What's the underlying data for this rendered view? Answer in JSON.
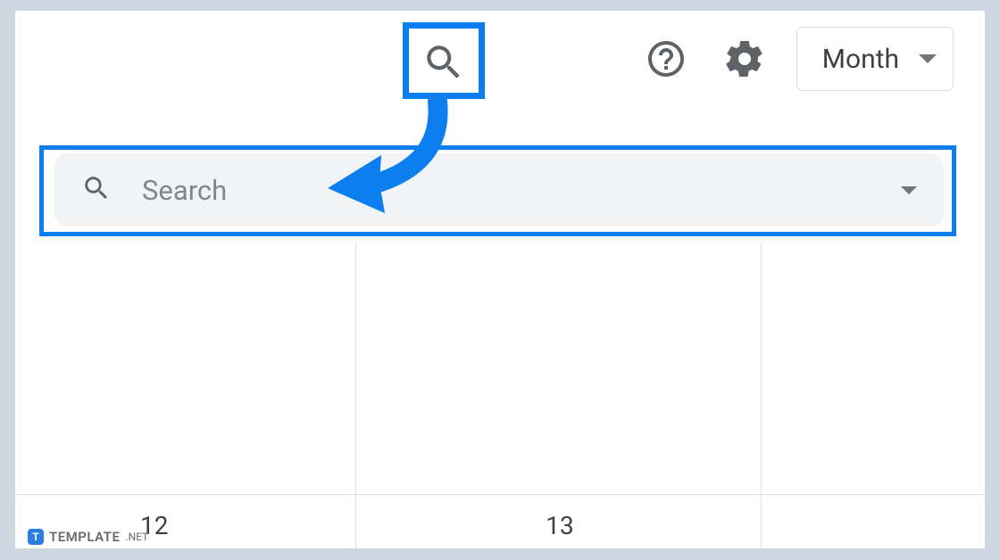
{
  "toolbar": {
    "view_label": "Month",
    "search_placeholder": "Search"
  },
  "calendar": {
    "days": [
      "12",
      "13"
    ]
  },
  "watermark": {
    "brand": "TEMPLATE",
    "suffix": ".NET",
    "icon_letter": "T"
  },
  "colors": {
    "highlight": "#0b7ff0",
    "icon_gray": "#5f6368"
  }
}
